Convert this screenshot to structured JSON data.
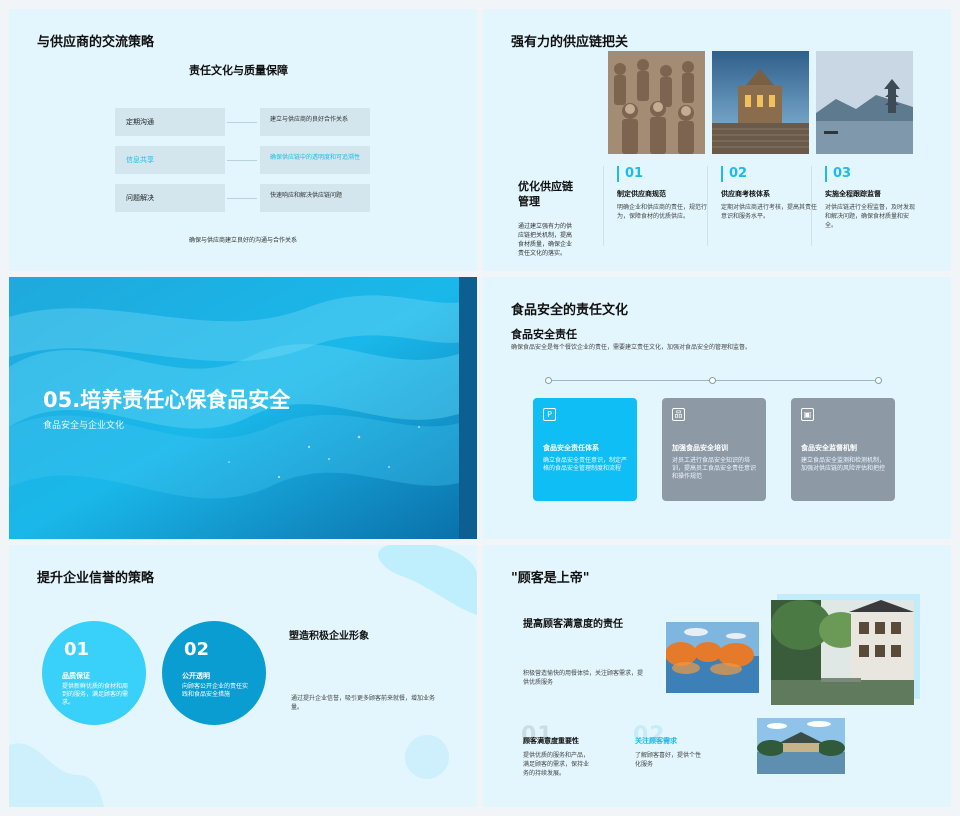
{
  "s1": {
    "title": "与供应商的交流策略",
    "subtitle": "责任文化与质量保障",
    "rows": [
      {
        "left": "定期沟通",
        "right": "建立与供应商的良好合作关系"
      },
      {
        "left": "信息共享",
        "right": "确保供应链中的透明度和可追溯性"
      },
      {
        "left": "问题解决",
        "right": "快速响应和解决供应链问题"
      }
    ],
    "footer": "确保与供应商建立良好的沟通与合作关系",
    "accent": "#1dbbe8"
  },
  "s2": {
    "title": "强有力的供应链把关",
    "left_title": "优化供应链管理",
    "left_desc": "通过建立强有力的供应链把关机制，提高食材质量，确保企业责任文化的落实。",
    "items": [
      {
        "num": "01",
        "head": "制定供应商规范",
        "desc": "明确企业和供应商的责任，规范行为，保障食材的优质供应。"
      },
      {
        "num": "02",
        "head": "供应商考核体系",
        "desc": "定期对供应商进行考核，提高其责任意识和服务水平。"
      },
      {
        "num": "03",
        "head": "实施全程跟踪监督",
        "desc": "对供应链进行全程监督，及时发现和解决问题，确保食材质量和安全。"
      }
    ]
  },
  "s3": {
    "title": "05.培养责任心保食品安全",
    "subtitle": "食品安全与企业文化"
  },
  "s4": {
    "title": "食品安全的责任文化",
    "subtitle": "食品安全责任",
    "desc": "确保食品安全是每个餐饮企业的责任，需要建立责任文化，加强对食品安全的管理和监督。",
    "cards": [
      {
        "head": "食品安全责任体系",
        "desc": "确立食品安全责任意识，制定严格的食品安全管理制度和流程",
        "color": "#0fbef5",
        "icon": "P"
      },
      {
        "head": "加强食品安全培训",
        "desc": "对员工进行食品安全知识的培训，提高员工食品安全责任意识和操作规范",
        "color": "#8d9aa6",
        "icon": "品"
      },
      {
        "head": "食品安全监督机制",
        "desc": "建立食品安全监测和检测机制，加强对供应链的风险评估和把控",
        "color": "#8d9aa6",
        "icon": "▣"
      }
    ]
  },
  "s5": {
    "title": "提升企业信誉的策略",
    "circles": [
      {
        "num": "01",
        "head": "品质保证",
        "desc": "提供新鲜优质的食材和周到的服务，满足顾客的需求。"
      },
      {
        "num": "02",
        "head": "公开透明",
        "desc": "向顾客公开企业的责任实践和食品安全措施"
      }
    ],
    "right_title": "塑造积极企业形象",
    "right_desc": "通过提升企业信誉，吸引更多顾客前来就餐，增加业务量。"
  },
  "s6": {
    "title": "\"顾客是上帝\"",
    "subtitle": "提高顾客满意度的责任",
    "desc": "积极营造愉快的用餐体验，关注顾客需求，提供优质服务",
    "items": [
      {
        "big": "01.",
        "head": "顾客满意度重要性",
        "desc": "提供优质的服务和产品，满足顾客的需求，保持业务的持续发展。"
      },
      {
        "big": "02.",
        "head": "关注顾客需求",
        "desc": "了解顾客喜好，提供个性化服务"
      }
    ]
  }
}
